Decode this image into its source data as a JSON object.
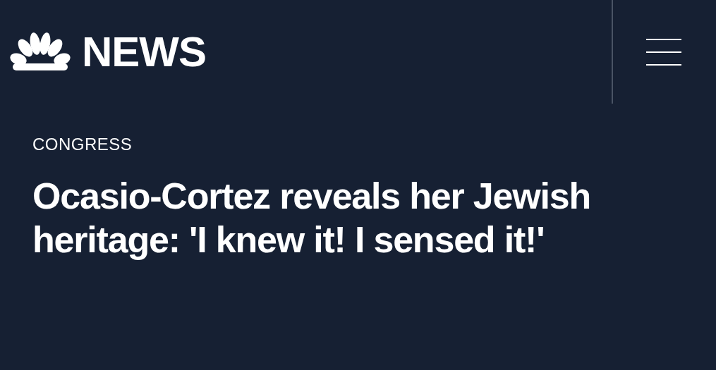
{
  "header": {
    "logo_text": "NEWS"
  },
  "article": {
    "category": "CONGRESS",
    "headline": "Ocasio-Cortez reveals her Jewish heritage: 'I knew it! I sensed it!'"
  }
}
